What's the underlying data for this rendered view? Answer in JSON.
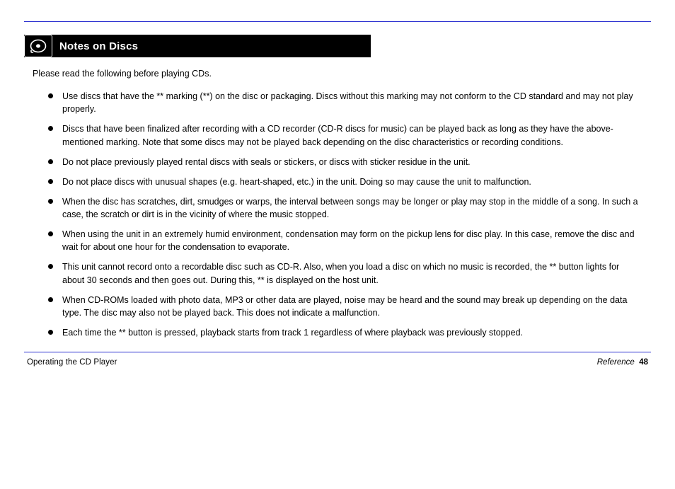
{
  "section": {
    "icon_name": "disc-icon",
    "title": "Notes on Discs"
  },
  "intro": "Please read the following before playing CDs.",
  "notes": [
    "Use discs that have the ** marking (**) on the disc or packaging. Discs without this marking may not conform to the CD standard and may not play properly.",
    "Discs that have been finalized after recording with a CD recorder (CD-R discs for music) can be played back as long as they have the above-mentioned marking. Note that some discs may not be played back depending on the disc characteristics or recording conditions.",
    "Do not place previously played rental discs with seals or stickers, or discs with sticker residue in the unit.",
    "Do not place discs with unusual shapes (e.g. heart-shaped, etc.) in the unit. Doing so may cause the unit to malfunction.",
    "When the disc has scratches, dirt, smudges or warps, the interval between songs may be longer or play may stop in the middle of a song. In such a case, the scratch or dirt is in the vicinity of where the music stopped.",
    "When using the unit in an extremely humid environment, condensation may form on the pickup lens for disc play. In this case, remove the disc and wait for about one hour for the condensation to evaporate.",
    "This unit cannot record onto a recordable disc such as CD-R. Also, when you load a disc on which no music is recorded, the ** button lights for about 30 seconds and then goes out. During this, ** is displayed on the host unit.",
    "When CD-ROMs loaded with photo data, MP3 or other data are played, noise may be heard and the sound may break up depending on the data type. The disc may also not be played back. This does not indicate a malfunction.",
    "Each time the ** button is pressed, playback starts from track 1 regardless of where playback was previously stopped."
  ],
  "footer": {
    "left": "Operating the CD Player",
    "right_label": "Reference",
    "page": "48"
  }
}
